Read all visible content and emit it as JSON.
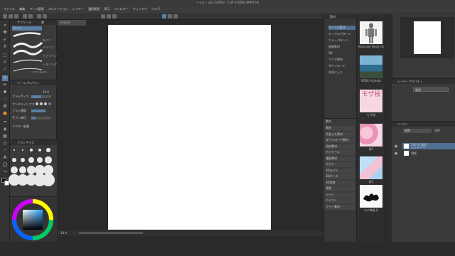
{
  "window": {
    "title": "イラスト.clip (100%) - CLIP STUDIO PAINT EX"
  },
  "menu": [
    "ファイル",
    "編集",
    "ページ管理",
    "アニメーション",
    "レイヤー",
    "選択範囲",
    "表示",
    "フィルター",
    "ウィンドウ",
    "ヘルプ"
  ],
  "document": {
    "tab_label": "イラスト"
  },
  "brush_panel": {
    "tabs": [
      "サブツール",
      "筆"
    ],
    "brushes": [
      "Gペン",
      "丸ペン",
      "ミリペン",
      "カブラペン",
      "レタリングペン",
      "リアルGペン"
    ]
  },
  "tool_property": {
    "title": "ツールプロパティ",
    "rows": [
      "ブラシサイズ",
      "アンチエイリアス",
      "ブラシ濃度",
      "手ブレ補正",
      "ベクター吸着"
    ],
    "brush_size_value": "10.0",
    "brush_size_fraction": 0.5
  },
  "brush_size_panel": {
    "title": "ブラシサイズ"
  },
  "materials": {
    "header": "素材",
    "tree": [
      "すべての素材",
      "モノクロパターン",
      "カラーパターン",
      "画像素材",
      "3D",
      "マンガ素材",
      "ダウンロード",
      "お気に入り"
    ],
    "tree2_title": "素材",
    "tree2": [
      "素材",
      "作画した素材",
      "ダウンロード素材",
      "追加素材",
      "ディテール",
      "漫画素材",
      "モデル",
      "3Dモデル",
      "3Dポーズ",
      "3D背景",
      "背景",
      "トーン",
      "アイコン",
      "フリー素材"
    ]
  },
  "thumbnails": [
    {
      "label": "Muscular Body shape",
      "icon": "anatomy-figure-icon"
    },
    {
      "label": "POSE A-photo",
      "icon": "landscape-photo-icon"
    },
    {
      "label": "モザ桜",
      "icon": "cherry-blossom-text-icon"
    },
    {
      "label": "桜1",
      "icon": "cherry-blossom-photo-icon"
    },
    {
      "label": "桜2",
      "icon": "cherry-blossom-sky-icon"
    },
    {
      "label": "モヤ線画 B",
      "icon": "ink-blot-icon"
    }
  ],
  "layer_property": {
    "title": "レイヤープロパティ",
    "blend_mode": "通常",
    "opacity": "100"
  },
  "layers": {
    "title": "レイヤー",
    "blend_mode": "通常",
    "opacity": "100",
    "items": [
      {
        "name": "100 % 通常",
        "sub": "レイヤー 1",
        "selected": true
      },
      {
        "name": "用紙",
        "sub": "",
        "selected": false
      }
    ]
  },
  "status": {
    "zoom": "14.4"
  },
  "colors": {
    "accent": "#4f6f95",
    "paper": "#ffffff",
    "bg": "#2a2a2a"
  }
}
